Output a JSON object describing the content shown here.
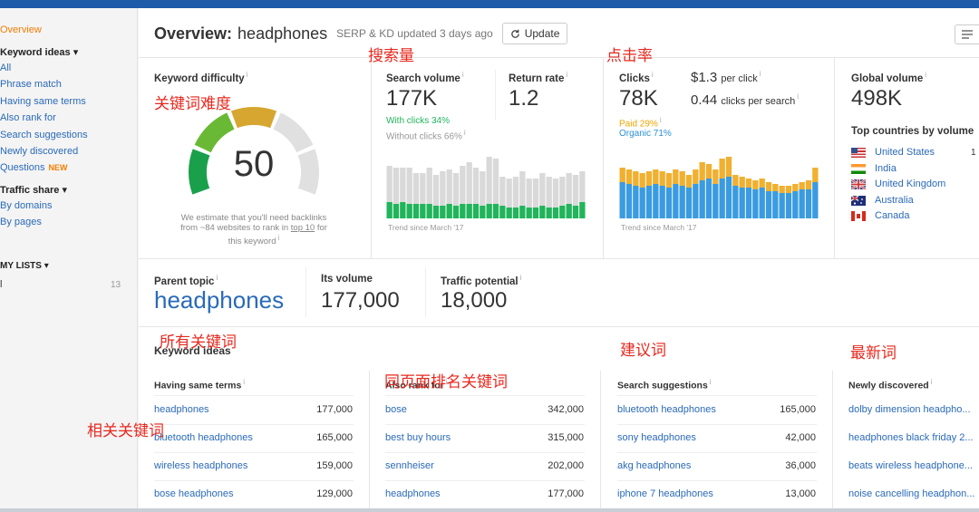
{
  "sidebar": {
    "overview": "Overview",
    "keyword_ideas": "Keyword ideas ▾",
    "items": [
      "All",
      "Phrase match",
      "Having same terms",
      "Also rank for",
      "Search suggestions",
      "Newly discovered",
      "Questions"
    ],
    "new_badge": "NEW",
    "traffic_share": "Traffic share ▾",
    "traffic_items": [
      "By domains",
      "By pages"
    ],
    "my_lists": "MY LISTS ▾",
    "list_name": "l",
    "list_count": "13"
  },
  "header": {
    "title_prefix": "Overview:",
    "keyword": "headphones",
    "subtitle": "SERP & KD updated 3 days ago",
    "update_label": "Update"
  },
  "kd": {
    "label": "Keyword difficulty",
    "value": "50",
    "score": 50,
    "note_1": "We estimate that you'll need backlinks",
    "note_2a": "from ~84 websites to rank in ",
    "note_link": "top 10",
    "note_2b": " for",
    "note_3": "this keyword"
  },
  "search_volume": {
    "label": "Search volume",
    "value": "177K",
    "with_clicks": "With clicks 34%",
    "without_clicks": "Without clicks 66%",
    "trend": "Trend since March '17",
    "bars_total": [
      58,
      56,
      56,
      56,
      50,
      50,
      56,
      48,
      52,
      54,
      50,
      58,
      62,
      56,
      52,
      68,
      66,
      46,
      44,
      46,
      52,
      44,
      44,
      50,
      46,
      44,
      46,
      50,
      48,
      52
    ],
    "bars_green": [
      18,
      16,
      18,
      16,
      16,
      16,
      16,
      14,
      14,
      16,
      14,
      16,
      16,
      16,
      14,
      16,
      16,
      14,
      12,
      12,
      14,
      12,
      12,
      14,
      12,
      12,
      14,
      16,
      14,
      18
    ]
  },
  "return_rate": {
    "label": "Return rate",
    "value": "1.2"
  },
  "clicks": {
    "label": "Clicks",
    "value": "78K",
    "cpc_value": "$1.3",
    "cpc_label": "per click",
    "cps_value": "0.44",
    "cps_label": "clicks per search",
    "paid": "Paid 29%",
    "organic": "Organic 71%",
    "trend": "Trend since March '17",
    "bars_total": [
      56,
      54,
      52,
      50,
      52,
      54,
      52,
      50,
      54,
      52,
      48,
      54,
      62,
      60,
      54,
      66,
      68,
      48,
      46,
      44,
      42,
      44,
      40,
      38,
      36,
      36,
      38,
      40,
      42,
      56
    ],
    "bars_blue": [
      40,
      38,
      36,
      34,
      36,
      38,
      36,
      34,
      38,
      36,
      34,
      38,
      42,
      44,
      38,
      44,
      46,
      36,
      34,
      34,
      32,
      34,
      30,
      30,
      28,
      28,
      30,
      32,
      32,
      40
    ]
  },
  "global_volume": {
    "label": "Global volume",
    "value": "498K",
    "top_countries_label": "Top countries by volume",
    "countries": [
      "United States",
      "India",
      "United Kingdom",
      "Australia",
      "Canada"
    ],
    "first_count": "1"
  },
  "parent_topic": {
    "label": "Parent topic",
    "keyword": "headphones",
    "volume_label": "Its volume",
    "volume": "177,000",
    "tp_label": "Traffic potential",
    "tp": "18,000"
  },
  "ideas": {
    "title": "Keyword ideas",
    "columns": [
      {
        "title": "Having same terms",
        "rows": [
          {
            "kw": "headphones",
            "v": "177,000"
          },
          {
            "kw": "bluetooth headphones",
            "v": "165,000"
          },
          {
            "kw": "wireless headphones",
            "v": "159,000"
          },
          {
            "kw": "bose headphones",
            "v": "129,000"
          }
        ]
      },
      {
        "title": "Also rank for",
        "rows": [
          {
            "kw": "bose",
            "v": "342,000"
          },
          {
            "kw": "best buy hours",
            "v": "315,000"
          },
          {
            "kw": "sennheiser",
            "v": "202,000"
          },
          {
            "kw": "headphones",
            "v": "177,000"
          }
        ]
      },
      {
        "title": "Search suggestions",
        "rows": [
          {
            "kw": "bluetooth headphones",
            "v": "165,000"
          },
          {
            "kw": "sony headphones",
            "v": "42,000"
          },
          {
            "kw": "akg headphones",
            "v": "36,000"
          },
          {
            "kw": "iphone 7 headphones",
            "v": "13,000"
          }
        ]
      },
      {
        "title": "Newly discovered",
        "rows": [
          {
            "kw": "dolby dimension headpho...",
            "v": ""
          },
          {
            "kw": "headphones black friday 2...",
            "v": ""
          },
          {
            "kw": "beats wireless headphone...",
            "v": ""
          },
          {
            "kw": "noise cancelling headphon...",
            "v": ""
          }
        ]
      }
    ]
  },
  "annotations": {
    "kd": "关键词难度",
    "search_volume": "搜索量",
    "ctr": "点击率",
    "all_keywords": "所有关键词",
    "related": "相关关键词",
    "same_page": "同页面排名关键词",
    "suggestions": "建议词",
    "newest": "最新词"
  },
  "colors": {
    "accent_blue": "#2a6ab8",
    "green": "#21b45b",
    "orange": "#f0a500",
    "light_blue": "#2a90d8",
    "annotation_red": "#e8281e"
  }
}
